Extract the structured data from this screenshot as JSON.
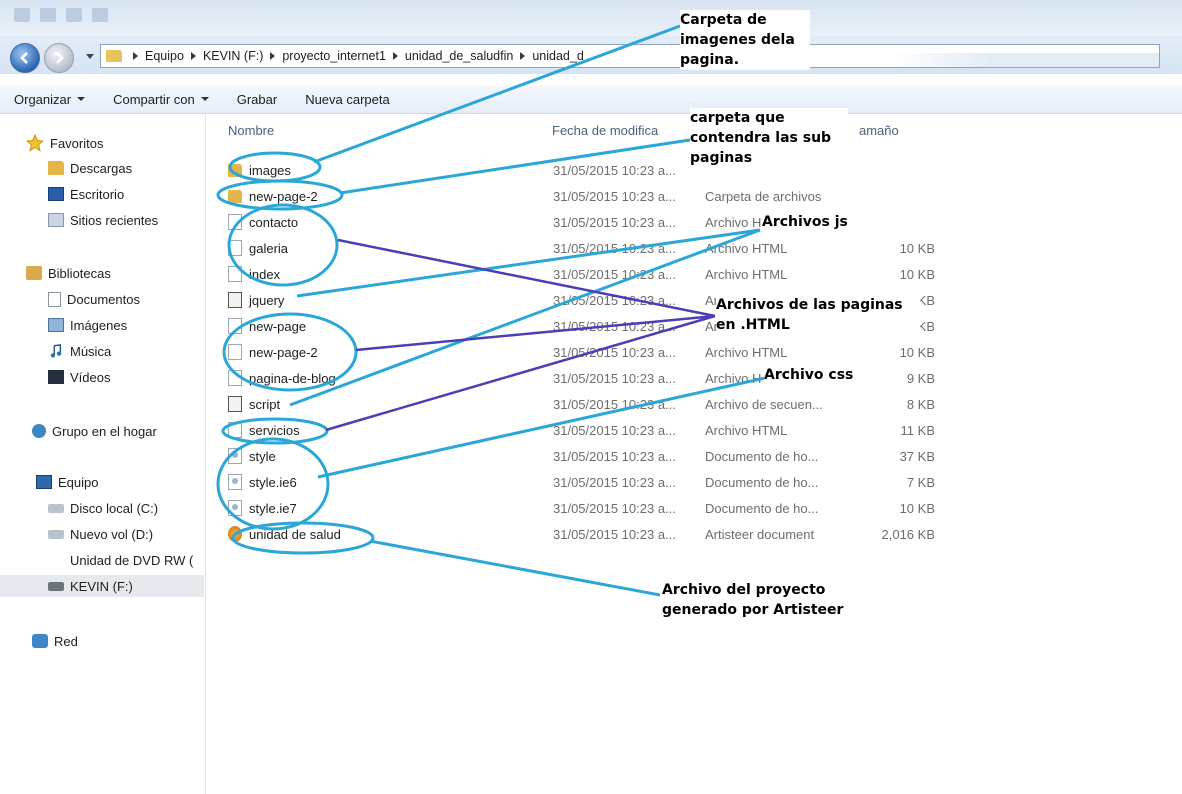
{
  "address": {
    "crumbs": [
      "Equipo",
      "KEVIN (F:)",
      "proyecto_internet1",
      "unidad_de_saludfin",
      "unidad_d"
    ]
  },
  "toolbar": {
    "organize": "Organizar",
    "share": "Compartir con",
    "burn": "Grabar",
    "new_folder": "Nueva carpeta"
  },
  "sidebar": {
    "favorites": "Favoritos",
    "downloads": "Descargas",
    "desktop": "Escritorio",
    "recent": "Sitios recientes",
    "libraries": "Bibliotecas",
    "documents": "Documentos",
    "images": "Imágenes",
    "music": "Música",
    "videos": "Vídeos",
    "homegroup": "Grupo en el hogar",
    "computer": "Equipo",
    "disk_c": "Disco local (C:)",
    "disk_d": "Nuevo vol (D:)",
    "dvd": "Unidad de DVD RW (",
    "kevin": "KEVIN (F:)",
    "network": "Red"
  },
  "columns": {
    "name": "Nombre",
    "date": "Fecha de modifica",
    "size": "amaño"
  },
  "files": [
    {
      "name": "images",
      "date": "31/05/2015 10:23 a...",
      "type": "",
      "size": "",
      "icon": "folder-icon"
    },
    {
      "name": "new-page-2",
      "date": "31/05/2015 10:23 a...",
      "type": "Carpeta de archivos",
      "size": "",
      "icon": "folder-icon"
    },
    {
      "name": "contacto",
      "date": "31/05/2015 10:23 a...",
      "type": "Archivo H",
      "size": "",
      "icon": "html-file-icon"
    },
    {
      "name": "galeria",
      "date": "31/05/2015 10:23 a...",
      "type": "Archivo HTML",
      "size": "10 KB",
      "icon": "html-file-icon"
    },
    {
      "name": "index",
      "date": "31/05/2015 10:23 a...",
      "type": "Archivo HTML",
      "size": "10 KB",
      "icon": "html-file-icon"
    },
    {
      "name": "jquery",
      "date": "31/05/2015 10:23 a...",
      "type": "Ar",
      "size": "KB",
      "icon": "script-file-icon"
    },
    {
      "name": "new-page",
      "date": "31/05/2015 10:23 a...",
      "type": "Ar",
      "size": "KB",
      "icon": "html-file-icon"
    },
    {
      "name": "new-page-2",
      "date": "31/05/2015 10:23 a...",
      "type": "Archivo HTML",
      "size": "10 KB",
      "icon": "html-file-icon"
    },
    {
      "name": "pagina-de-blog",
      "date": "31/05/2015 10:23 a...",
      "type": "Archivo H",
      "size": "9 KB",
      "icon": "html-file-icon"
    },
    {
      "name": "script",
      "date": "31/05/2015 10:23 a...",
      "type": "Archivo de secuen...",
      "size": "8 KB",
      "icon": "script-file-icon"
    },
    {
      "name": "servicios",
      "date": "31/05/2015 10:23 a...",
      "type": "Archivo HTML",
      "size": "11 KB",
      "icon": "html-file-icon"
    },
    {
      "name": "style",
      "date": "31/05/2015 10:23 a...",
      "type": "Documento de ho...",
      "size": "37 KB",
      "icon": "css-file-icon"
    },
    {
      "name": "style.ie6",
      "date": "31/05/2015 10:23 a...",
      "type": "Documento de ho...",
      "size": "7 KB",
      "icon": "css-file-icon"
    },
    {
      "name": "style.ie7",
      "date": "31/05/2015 10:23 a...",
      "type": "Documento de ho...",
      "size": "10 KB",
      "icon": "css-file-icon"
    },
    {
      "name": "unidad de salud",
      "date": "31/05/2015 10:23 a...",
      "type": "Artisteer document",
      "size": "2,016 KB",
      "icon": "artisteer-file-icon"
    }
  ],
  "annotations": {
    "images_folder": "Carpeta de\nimagenes dela\npagina.",
    "subpages_folder": "carpeta que\ncontendra las sub\npaginas",
    "js_files": "Archivos js",
    "html_files": "Archivos de las paginas\nen .HTML",
    "css_file": "Archivo css",
    "artisteer_file": "Archivo del proyecto\ngenerado por Artisteer"
  },
  "colors": {
    "callout_cyan": "#2aa7d8",
    "callout_purple": "#4a3fb4"
  }
}
